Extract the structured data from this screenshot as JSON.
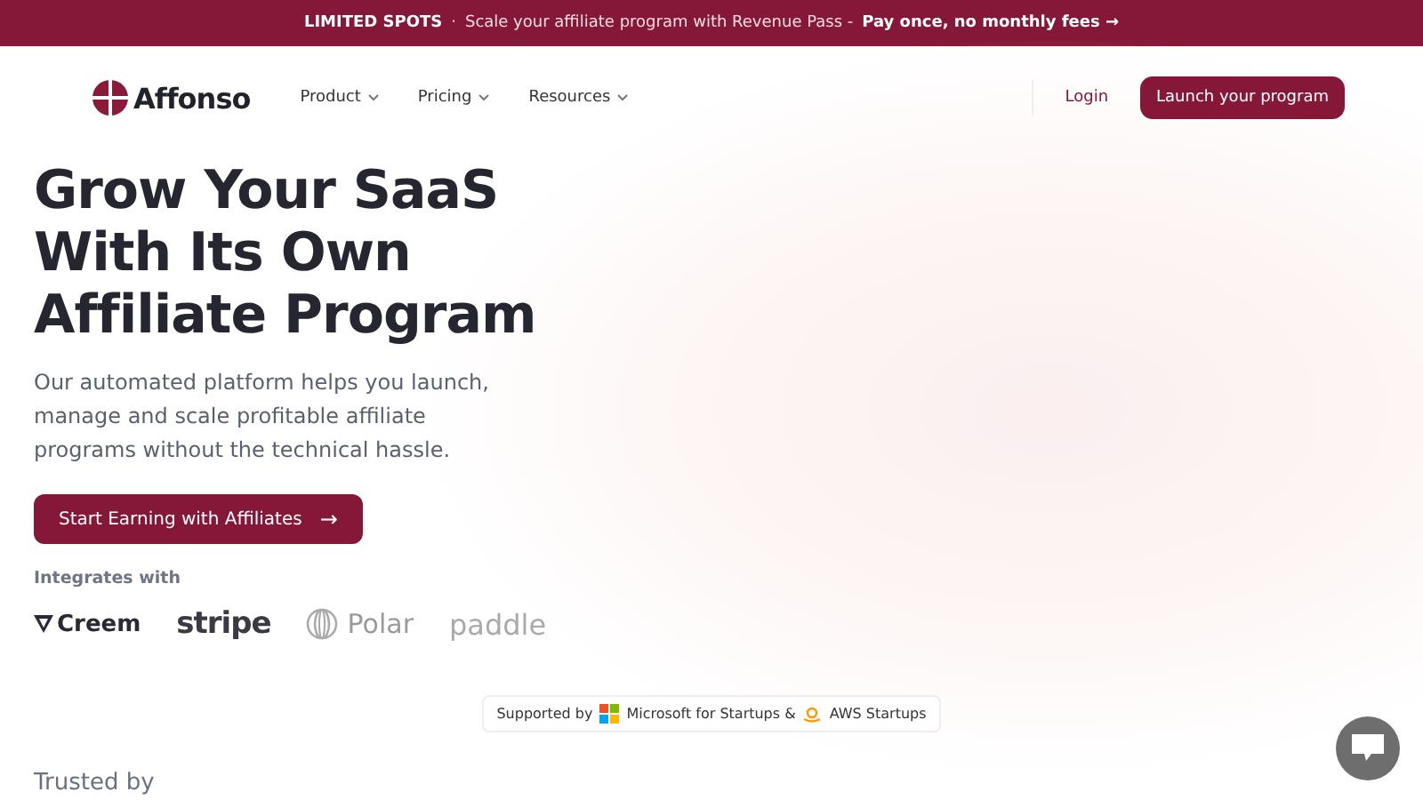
{
  "banner": {
    "label": "LIMITED SPOTS",
    "separator": "·",
    "text": "Scale your affiliate program with Revenue Pass -",
    "emphasis": "Pay once, no monthly fees",
    "arrow": "→"
  },
  "nav": {
    "logo": "Affonso",
    "menu": [
      {
        "label": "Product"
      },
      {
        "label": "Pricing"
      },
      {
        "label": "Resources"
      }
    ],
    "login": "Login",
    "cta": "Launch your program"
  },
  "hero": {
    "headline": [
      "Grow Your SaaS",
      "With Its Own",
      "Affiliate Program"
    ],
    "description": "Our automated platform helps you launch, manage and scale profitable affiliate programs without the technical hassle.",
    "button": "Start Earning with Affiliates",
    "button_arrow": "→"
  },
  "integrations": {
    "title": "Integrates with",
    "logos": [
      {
        "kind": "creem",
        "name": "Creem"
      },
      {
        "kind": "stripe",
        "name": "stripe"
      },
      {
        "kind": "polar",
        "name": "Polar"
      },
      {
        "kind": "paddle",
        "name": "paddle"
      }
    ]
  },
  "support": {
    "prefix": "Supported by",
    "items": [
      {
        "kind": "microsoft",
        "label": "Microsoft for Startups &"
      },
      {
        "kind": "aws",
        "label": "AWS Startups"
      }
    ]
  },
  "trusted": {
    "title": "Trusted by"
  }
}
